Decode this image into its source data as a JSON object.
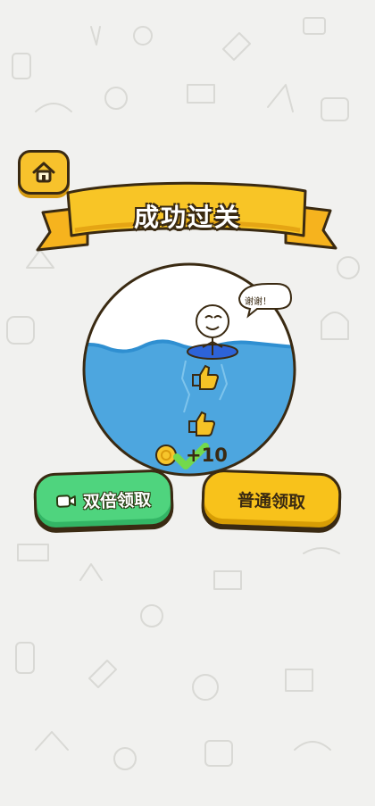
{
  "header": {
    "title": "成功过关"
  },
  "scene": {
    "speech": "谢谢！",
    "reward_amount": "+10"
  },
  "actions": {
    "double_claim": "双倍领取",
    "normal_claim": "普通领取"
  },
  "icons": {
    "home": "home-icon",
    "video": "video-icon",
    "coin": "coin-icon",
    "thumbs_up": "thumbs-up-icon"
  },
  "colors": {
    "banner": "#f7bf25",
    "water": "#4da6df",
    "double_button": "#4fd47e",
    "normal_button": "#f8c21b"
  }
}
